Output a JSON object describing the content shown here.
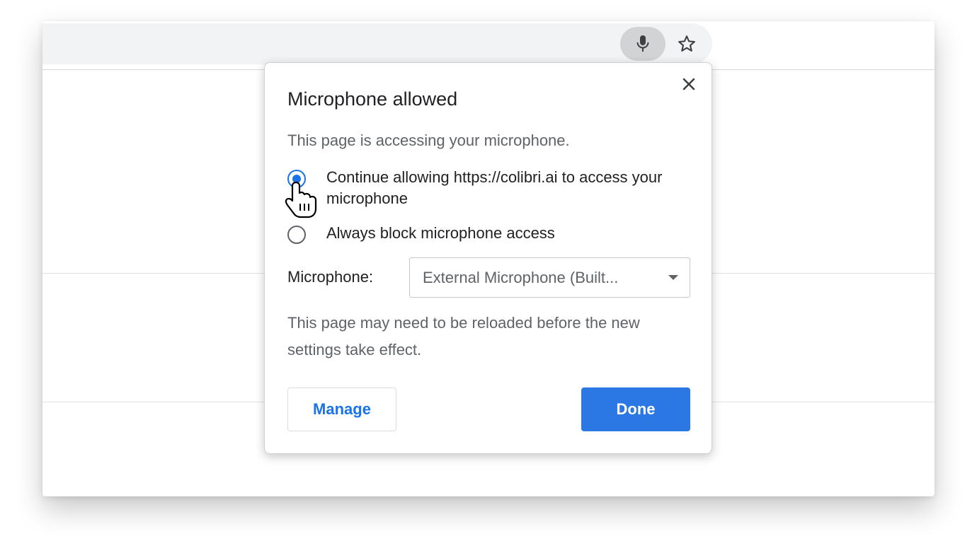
{
  "toolbar": {
    "mic_icon": "microphone-icon",
    "star_icon": "star-outline-icon"
  },
  "dialog": {
    "title": "Microphone allowed",
    "description": "This page is accessing your microphone.",
    "options": [
      {
        "label": "Continue allowing https://colibri.ai to access your microphone",
        "selected": true
      },
      {
        "label": "Always block microphone access",
        "selected": false
      }
    ],
    "microphone_label": "Microphone:",
    "microphone_selected": "External Microphone (Built...",
    "reload_note": "This page may need to be reloaded before the new settings take effect.",
    "manage_label": "Manage",
    "done_label": "Done",
    "close_icon": "close-icon"
  },
  "colors": {
    "accent": "#1a73e8",
    "done_button": "#2b77e3",
    "mic_chip": "#d2d3d5",
    "omnibox": "#f1f3f4"
  }
}
